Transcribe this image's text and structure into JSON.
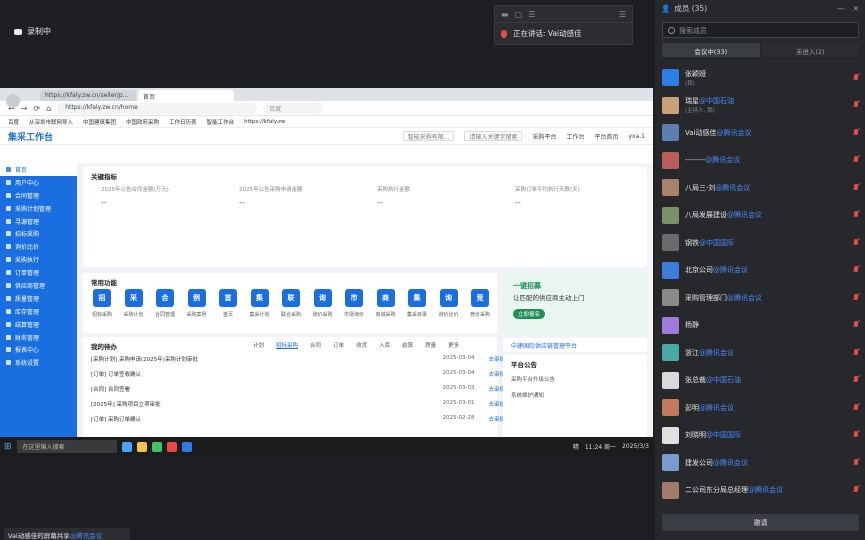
{
  "recording_status": "录制中",
  "speaker_window": {
    "text": "正在讲话: Vai动感佳"
  },
  "browser": {
    "tabs": [
      "https://kfaly.zw.cn/seller/p...",
      "首页"
    ],
    "url": "https://kfaly.zw.cn/home",
    "search_placeholder": "百度",
    "bookmarks": [
      "百度",
      "从深圳市联网导入",
      "中国建筑集团",
      "中国政府采购",
      "工作日历表",
      "智能工作台",
      "https://kfaly.zw"
    ]
  },
  "app": {
    "logo": "集采工作台",
    "company_select": "智能采购有限...",
    "search_placeholder": "请输入关键字搜索",
    "header_links": [
      "采购平台",
      "工作台",
      "平台首页"
    ],
    "user": "yxa.1"
  },
  "sidebar": [
    "首页",
    "用户中心",
    "合同管理",
    "采购计划管理",
    "寻源管理",
    "招标采购",
    "询价比价",
    "采购执行",
    "订单管理",
    "供应商管理",
    "质量管理",
    "库存管理",
    "结算管理",
    "财务管理",
    "报表中心",
    "系统设置"
  ],
  "key_indicators": {
    "title": "关键指标",
    "items": [
      {
        "label": "2025年公告合同金额(万元)",
        "value": "--"
      },
      {
        "label": "2025年公告采购申请金额",
        "value": "--"
      },
      {
        "label": "采购执行金额",
        "value": "--"
      },
      {
        "label": "采购订单平均执行天数(天)",
        "value": "--"
      }
    ]
  },
  "common_functions": {
    "title": "常用功能",
    "items": [
      {
        "icon": "招",
        "label": "招标采购"
      },
      {
        "icon": "采",
        "label": "采购计划"
      },
      {
        "icon": "合",
        "label": "合同管理"
      },
      {
        "icon": "例",
        "label": "采购案例"
      },
      {
        "icon": "首",
        "label": "首页"
      },
      {
        "icon": "集",
        "label": "集采计划"
      },
      {
        "icon": "联",
        "label": "联合采购"
      },
      {
        "icon": "询",
        "label": "询价采购"
      },
      {
        "icon": "市",
        "label": "市场询价"
      },
      {
        "icon": "商",
        "label": "商城采购"
      },
      {
        "icon": "集",
        "label": "集采目录"
      },
      {
        "icon": "询",
        "label": "询价比价"
      },
      {
        "icon": "竞",
        "label": "竞价采购"
      }
    ]
  },
  "todos": {
    "title": "我的待办",
    "tabs": [
      "计划",
      "招标采购",
      "合同",
      "订单",
      "收货",
      "入库",
      "结算",
      "质量",
      "更多"
    ],
    "rows": [
      {
        "text": "[采购计划] 采购申请(2025年)采购计划审批",
        "time": "2025-03-04",
        "action": "去审批"
      },
      {
        "text": "[订单] 订单签收确认",
        "time": "2025-03-04",
        "action": "去审批"
      },
      {
        "text": "[合同] 合同签署",
        "time": "2025-03-03",
        "action": "去审批"
      },
      {
        "text": "[2025年] 采购项目立项审批",
        "time": "2025-03-01",
        "action": "去审批"
      },
      {
        "text": "[订单] 采购订单确认",
        "time": "2025-02-28",
        "action": "去审批"
      }
    ]
  },
  "banner": {
    "line1": "一键招募",
    "line2": "让匹配的供应商主动上门",
    "button": "立即报名",
    "link": "中建国际供应链管理平台"
  },
  "announcement": {
    "title": "平台公告",
    "items": [
      "采购平台升级公告",
      "系统维护通知"
    ]
  },
  "taskbar": {
    "search": "在这里输入搜索",
    "weather": "晴",
    "time": "11:24 周一",
    "date": "2025/3/3"
  },
  "members_panel": {
    "title": "成员 (35)",
    "search_placeholder": "搜索成员",
    "tabs": [
      "会议中(33)",
      "未进入(2)"
    ],
    "members": [
      {
        "name": "张颖娅",
        "sub": "(我)",
        "color": "#2d7de8"
      },
      {
        "name": "瑞星",
        "hl": "@中国石油",
        "sub": "(主持人, 我)",
        "color": "#c9a27a"
      },
      {
        "name": "Vai动感佳",
        "hl": "@腾讯会议",
        "sub": "",
        "color": "#5b7fb0"
      },
      {
        "name": "--------",
        "hl": "@腾讯会议",
        "sub": "",
        "color": "#b85c5c"
      },
      {
        "name": "八局三·刘",
        "hl": "@腾讯会议",
        "sub": "",
        "color": "#a8836a"
      },
      {
        "name": "八局发展建设",
        "hl": "@腾讯会议",
        "sub": "",
        "color": "#7a8f6a"
      },
      {
        "name": "钢铁",
        "hl": "@中国国际",
        "sub": "",
        "color": "#6a6a6a"
      },
      {
        "name": "北京公司",
        "hl": "@腾讯会议",
        "sub": "",
        "color": "#3d7bd9"
      },
      {
        "name": "采购管理部门",
        "hl": "@腾讯会议",
        "sub": "",
        "color": "#8a8a8a"
      },
      {
        "name": "杨静",
        "hl": "",
        "sub": "",
        "color": "#9d7bd9"
      },
      {
        "name": "浙江",
        "hl": "@腾讯会议",
        "sub": "",
        "color": "#4aa8a8"
      },
      {
        "name": "张总裁",
        "hl": "@中国石油",
        "sub": "",
        "color": "#d9d9d9"
      },
      {
        "name": "彭明",
        "hl": "@腾讯会议",
        "sub": "",
        "color": "#c27a5c"
      },
      {
        "name": "刘晓明",
        "hl": "@中国国际",
        "sub": "",
        "color": "#e0e0e0"
      },
      {
        "name": "建发公司",
        "hl": "@腾讯会议",
        "sub": "",
        "color": "#7a9bd0"
      },
      {
        "name": "二公司东分局总经理",
        "hl": "@腾讯会议",
        "sub": "",
        "color": "#a07a6a"
      }
    ],
    "invite_button": "邀请"
  },
  "bottom_note": {
    "text": "Vai动感佳的屏幕共享",
    "hl": "@腾讯会议"
  }
}
